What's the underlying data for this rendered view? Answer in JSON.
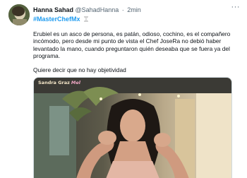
{
  "tweet": {
    "author_name": "Hanna Sahad",
    "author_handle": "@SahadHanna",
    "separator": "·",
    "time": "2min",
    "hashtag": "#MasterChefMx",
    "hashtag_emoji_icon": "hourglass-icon",
    "more_icon": "more-options-icon",
    "more_glyph": "···",
    "paragraphs": [
      "Erubiel es un asco de persona, es patán, odioso, cochino, es el compañero incómodo, pero desde mi punto de vista el Chef JoseRa no debió haber levantado la mano, cuando preguntaron quién deseaba que se fuera ya del programa.",
      "Quiere decir que no hay objetividad"
    ],
    "media": {
      "watermark_name": "Sandra Graz",
      "watermark_tag": "Mel"
    }
  },
  "colors": {
    "hashtag": "#1d9bf0",
    "secondary_text": "#536471",
    "border": "#cfd9de"
  }
}
